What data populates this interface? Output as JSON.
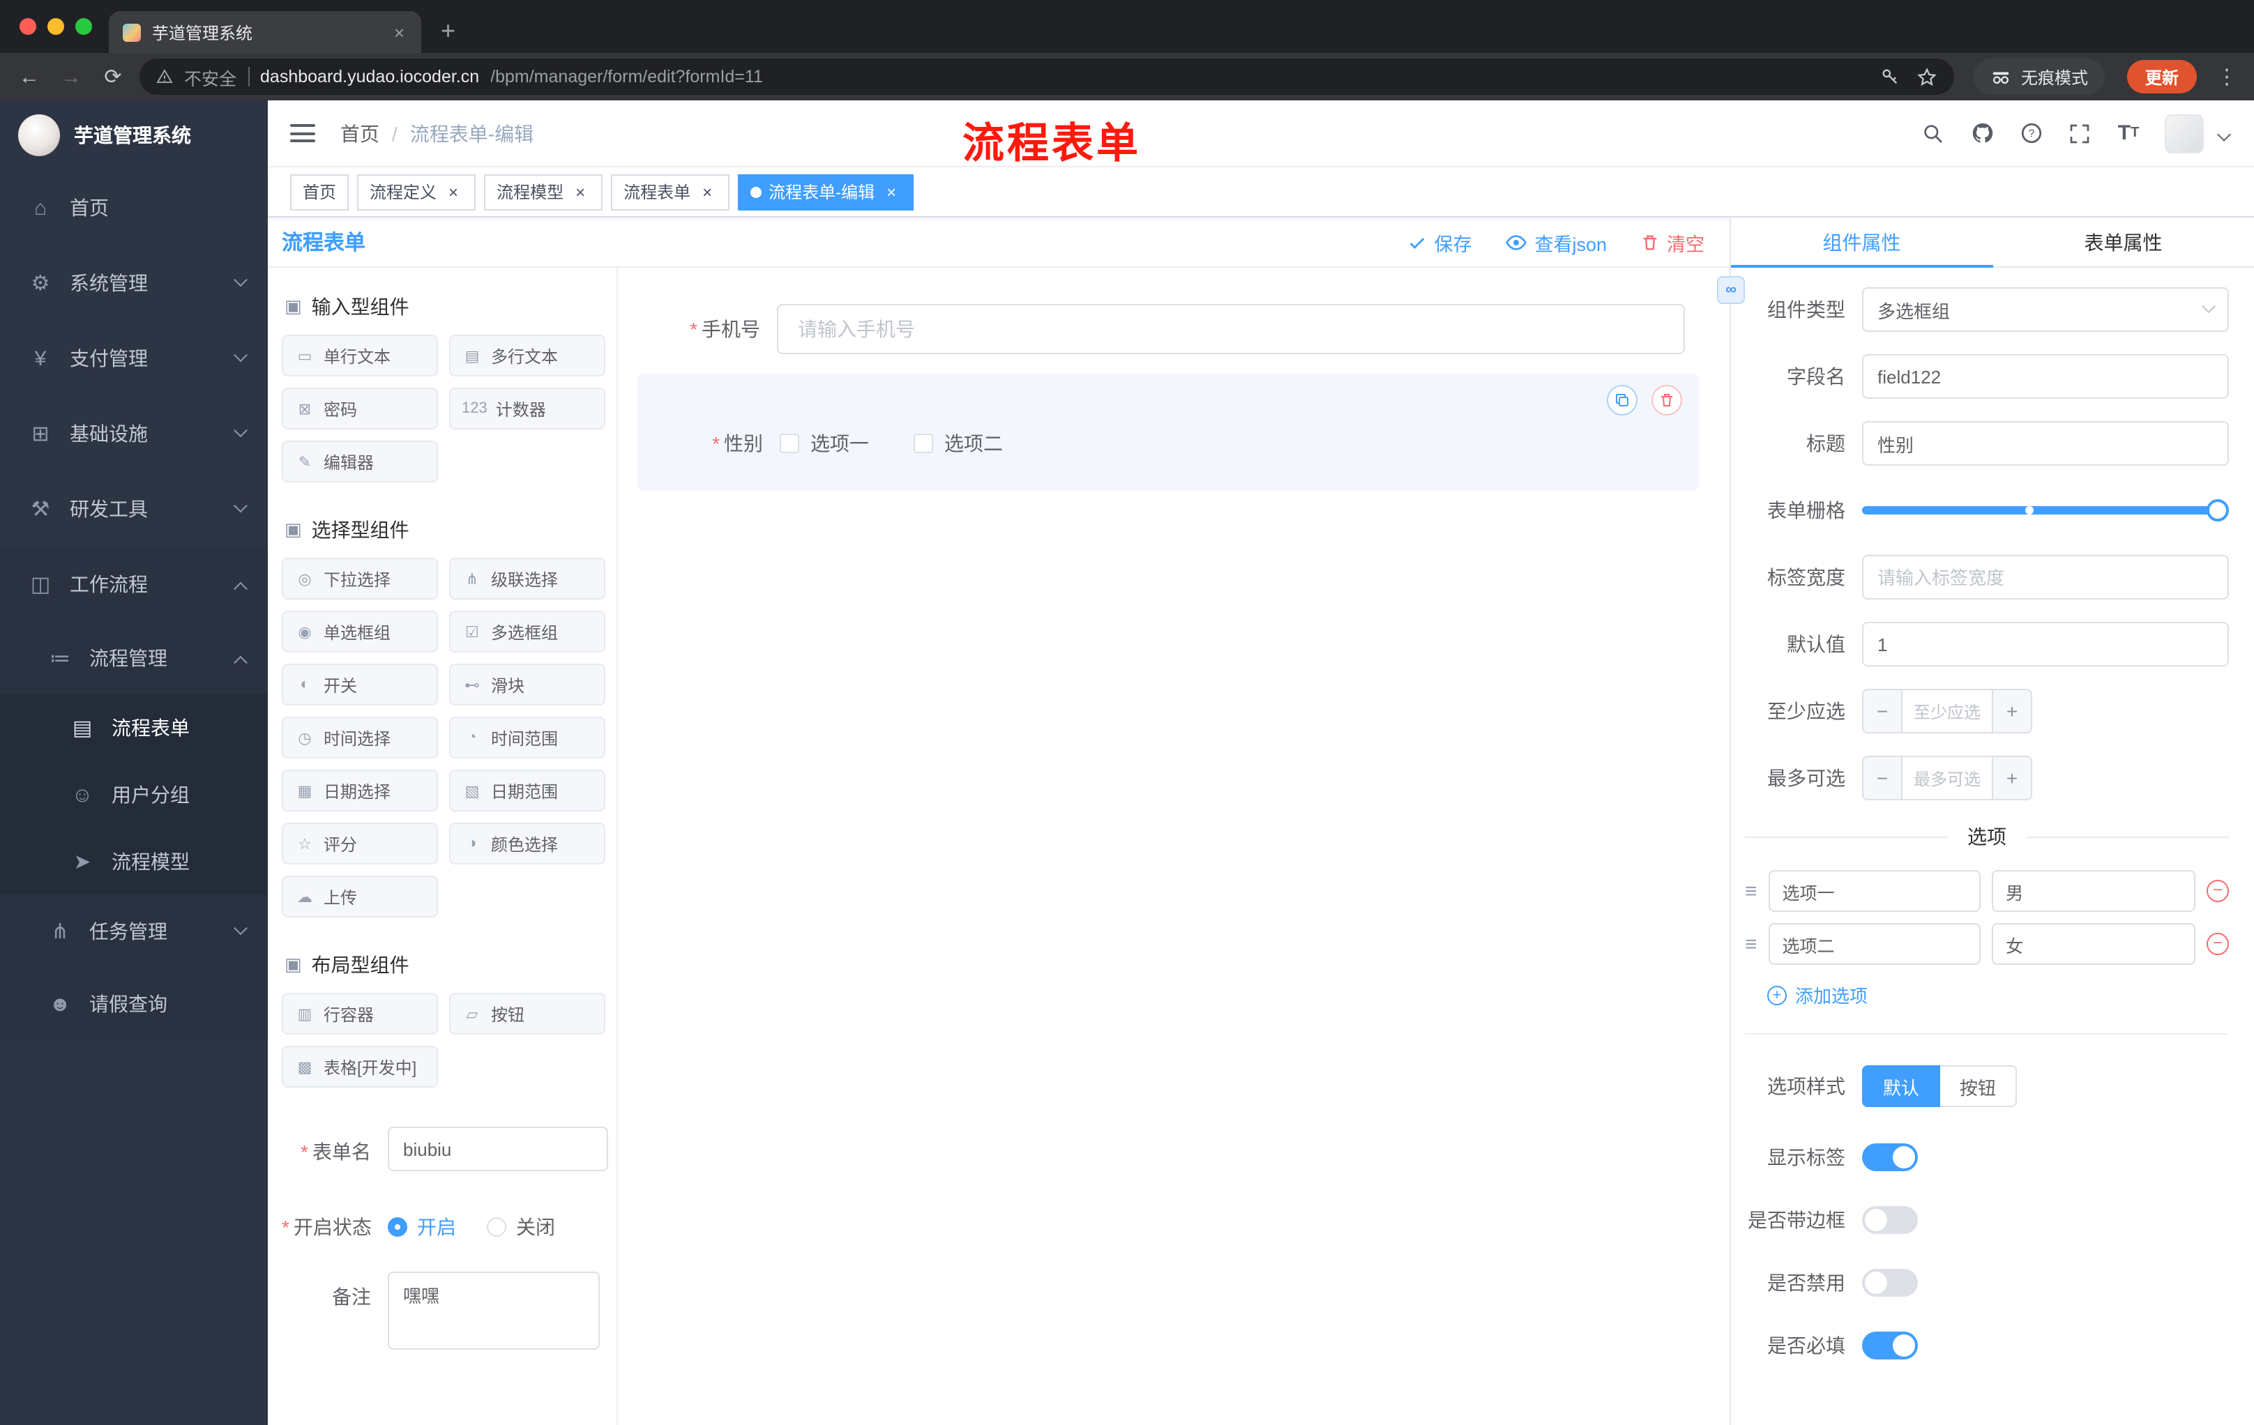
{
  "ui": {
    "required_mark": "*",
    "close_x": "×"
  },
  "colors": {
    "accent": "#409eff",
    "danger": "#f56c6c",
    "annotation": "#ff1a0e",
    "update_pill": "#e0532f",
    "sidebar_bg": "#2d3444",
    "chrome_bg": "#202124"
  },
  "browser": {
    "tab_title": "芋道管理系统",
    "new_tab": "+",
    "back": "←",
    "forward": "→",
    "reload": "⟳",
    "security_warning": "不安全",
    "url_host": "dashboard.yudao.iocoder.cn",
    "url_path": "/bpm/manager/form/edit?formId=11",
    "incognito_label": "无痕模式",
    "update_label": "更新",
    "menu_dots": "⋮"
  },
  "sidebar": {
    "logo": "芋道管理系统",
    "items": [
      {
        "label": "首页",
        "icon": "⌂"
      },
      {
        "label": "系统管理",
        "icon": "⚙"
      },
      {
        "label": "支付管理",
        "icon": "¥"
      },
      {
        "label": "基础设施",
        "icon": "⊞"
      },
      {
        "label": "研发工具",
        "icon": "⚒"
      },
      {
        "label": "工作流程",
        "icon": "◫"
      }
    ],
    "sub": {
      "process_mgmt": {
        "label": "流程管理",
        "icon": "≔"
      },
      "leaves": [
        {
          "label": "流程表单",
          "icon": "▤"
        },
        {
          "label": "用户分组",
          "icon": "☺"
        },
        {
          "label": "流程模型",
          "icon": "➤"
        }
      ],
      "task_mgmt": {
        "label": "任务管理",
        "icon": "⋔"
      },
      "leave_query": {
        "label": "请假查询",
        "icon": "☻"
      }
    }
  },
  "header": {
    "breadcrumb_home": "首页",
    "breadcrumb_sep": "/",
    "breadcrumb_current": "流程表单-编辑"
  },
  "annotation": "流程表单",
  "tags": [
    {
      "label": "首页"
    },
    {
      "label": "流程定义"
    },
    {
      "label": "流程模型"
    },
    {
      "label": "流程表单"
    },
    {
      "label": "流程表单-编辑"
    }
  ],
  "designer": {
    "title": "流程表单",
    "toolbar": {
      "save": "保存",
      "view_json": "查看json",
      "clear": "清空"
    },
    "palette": {
      "groups": [
        {
          "title": "输入型组件",
          "items": [
            {
              "label": "单行文本",
              "icon": "▭"
            },
            {
              "label": "多行文本",
              "icon": "▤"
            },
            {
              "label": "密码",
              "icon": "⊠"
            },
            {
              "label": "计数器",
              "icon": "123"
            },
            {
              "label": "编辑器",
              "icon": "✎"
            }
          ]
        },
        {
          "title": "选择型组件",
          "items": [
            {
              "label": "下拉选择",
              "icon": "◎"
            },
            {
              "label": "级联选择",
              "icon": "⋔"
            },
            {
              "label": "单选框组",
              "icon": "◉"
            },
            {
              "label": "多选框组",
              "icon": "☑"
            },
            {
              "label": "开关",
              "icon": "◐"
            },
            {
              "label": "滑块",
              "icon": "⊷"
            },
            {
              "label": "时间选择",
              "icon": "◷"
            },
            {
              "label": "时间范围",
              "icon": "◔"
            },
            {
              "label": "日期选择",
              "icon": "▦"
            },
            {
              "label": "日期范围",
              "icon": "▧"
            },
            {
              "label": "评分",
              "icon": "☆"
            },
            {
              "label": "颜色选择",
              "icon": "◑"
            },
            {
              "label": "上传",
              "icon": "☁"
            }
          ]
        },
        {
          "title": "布局型组件",
          "items": [
            {
              "label": "行容器",
              "icon": "▥"
            },
            {
              "label": "按钮",
              "icon": "▱"
            },
            {
              "label": "表格[开发中]",
              "icon": "▩"
            }
          ]
        }
      ]
    },
    "meta_form": {
      "name_label": "表单名",
      "name_value": "biubiu",
      "status_label": "开启状态",
      "status_on": "开启",
      "status_off": "关闭",
      "remark_label": "备注",
      "remark_value": "嘿嘿"
    },
    "canvas": {
      "phone": {
        "label": "手机号",
        "placeholder": "请输入手机号"
      },
      "gender": {
        "label": "性别",
        "options": [
          "选项一",
          "选项二"
        ]
      }
    }
  },
  "props": {
    "tabs": [
      {
        "label": "组件属性"
      },
      {
        "label": "表单属性"
      }
    ],
    "rows": {
      "component_type": {
        "label": "组件类型",
        "value": "多选框组"
      },
      "field_name": {
        "label": "字段名",
        "value": "field122"
      },
      "title": {
        "label": "标题",
        "value": "性别"
      },
      "grid": {
        "label": "表单栅格"
      },
      "label_width": {
        "label": "标签宽度",
        "placeholder": "请输入标签宽度"
      },
      "default_value": {
        "label": "默认值",
        "value": "1"
      },
      "min_select": {
        "label": "至少应选",
        "placeholder": "至少应选",
        "minus": "−",
        "plus": "+"
      },
      "max_select": {
        "label": "最多可选",
        "placeholder": "最多可选",
        "minus": "−",
        "plus": "+"
      }
    },
    "options_section": {
      "title": "选项",
      "options": [
        {
          "label": "选项一",
          "value": "男",
          "remove": "−"
        },
        {
          "label": "选项二",
          "value": "女",
          "remove": "−"
        }
      ],
      "add_plus": "+",
      "add_label": "添加选项"
    },
    "style_row": {
      "label": "选项样式",
      "choice_default": "默认",
      "choice_button": "按钮"
    },
    "switch_rows": [
      {
        "label": "显示标签"
      },
      {
        "label": "是否带边框"
      },
      {
        "label": "是否禁用"
      },
      {
        "label": "是否必填"
      }
    ]
  }
}
